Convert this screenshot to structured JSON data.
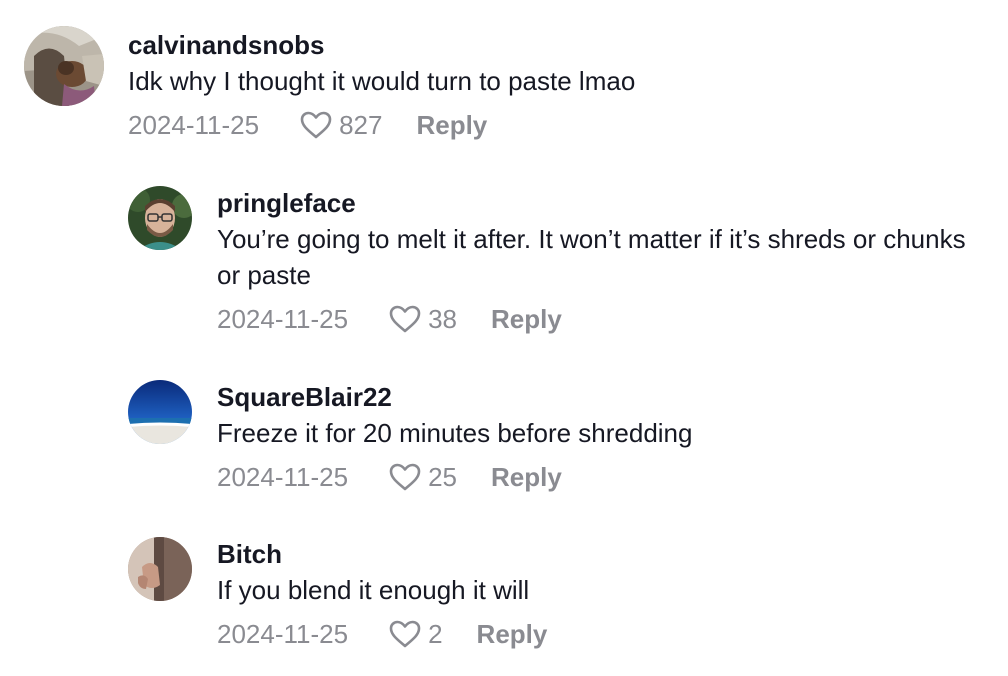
{
  "comments": [
    {
      "username": "calvinandsnobs",
      "text": "Idk why I thought it would turn to paste lmao",
      "date": "2024-11-25",
      "likes": "827",
      "reply_label": "Reply"
    },
    {
      "username": "pringleface",
      "text": "You’re going to melt it after. It won’t matter if it’s shreds or chunks or paste",
      "date": "2024-11-25",
      "likes": "38",
      "reply_label": "Reply"
    },
    {
      "username": "SquareBlair22",
      "text": "Freeze it for 20 minutes before shredding",
      "date": "2024-11-25",
      "likes": "25",
      "reply_label": "Reply"
    },
    {
      "username": "Bitch",
      "text": "If you blend it enough it will",
      "date": "2024-11-25",
      "likes": "2",
      "reply_label": "Reply"
    }
  ],
  "colors": {
    "text_primary": "#161823",
    "text_secondary": "#8a8b91",
    "background": "#ffffff"
  },
  "icons": {
    "like": "heart-outline-icon"
  }
}
